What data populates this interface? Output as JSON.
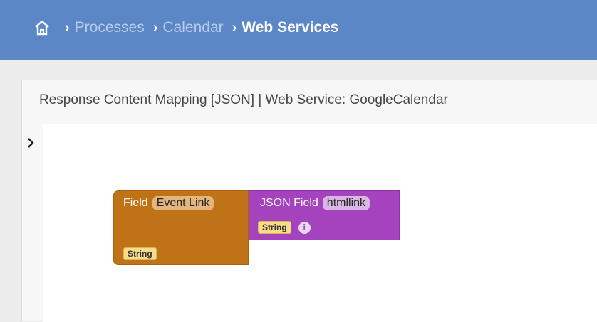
{
  "breadcrumb": {
    "separator": "›",
    "items": [
      "Processes",
      "Calendar"
    ],
    "current": "Web Services"
  },
  "panel": {
    "title": "Response Content Mapping [JSON]  |  Web Service: GoogleCalendar",
    "toggle_icon": "chevron-right-icon"
  },
  "blocks": {
    "field": {
      "label": "Field",
      "value": "Event Link",
      "type": "String"
    },
    "json_field": {
      "label": "JSON Field",
      "value": "htmllink",
      "type": "String",
      "info_glyph": "i"
    }
  },
  "colors": {
    "header": "#5b87c7",
    "field_block": "#c07316",
    "json_block": "#a542be",
    "type_tag": "#f8dc88"
  }
}
